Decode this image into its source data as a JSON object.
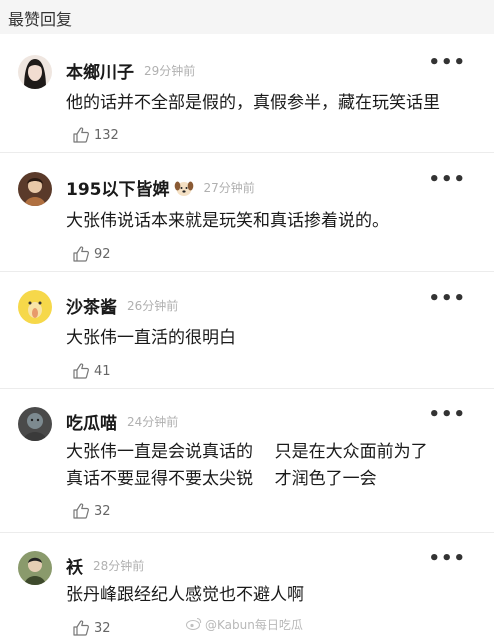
{
  "section_title": "最赞回复",
  "comments": [
    {
      "username": "本鄉川子",
      "time": "29分钟前",
      "text": "他的话并不全部是假的，真假参半，藏在玩笑话里",
      "likes": "132",
      "avatar_color": "#e8ded8"
    },
    {
      "username": "195以下皆婢",
      "time": "27分钟前",
      "text": "大张伟说话本来就是玩笑和真话掺着说的。",
      "likes": "92",
      "avatar_color": "#c9a27a",
      "emoji": "dog-face-icon"
    },
    {
      "username": "沙茶酱",
      "time": "26分钟前",
      "text": "大张伟一直活的很明白",
      "likes": "41",
      "avatar_color": "#f3d23c"
    },
    {
      "username": "吃瓜喵",
      "time": "24分钟前",
      "text_lines": [
        "大张伟一直是会说真话的    只是在大众面前为了",
        "真话不要显得不要太尖锐    才润色了一会"
      ],
      "likes": "32",
      "avatar_color": "#6b6b6b"
    },
    {
      "username": "袄",
      "time": "28分钟前",
      "text": "张丹峰跟经纪人感觉也不避人啊",
      "likes": "32",
      "avatar_color": "#7a8a5c"
    }
  ],
  "watermark": "@Kabun每日吃瓜"
}
